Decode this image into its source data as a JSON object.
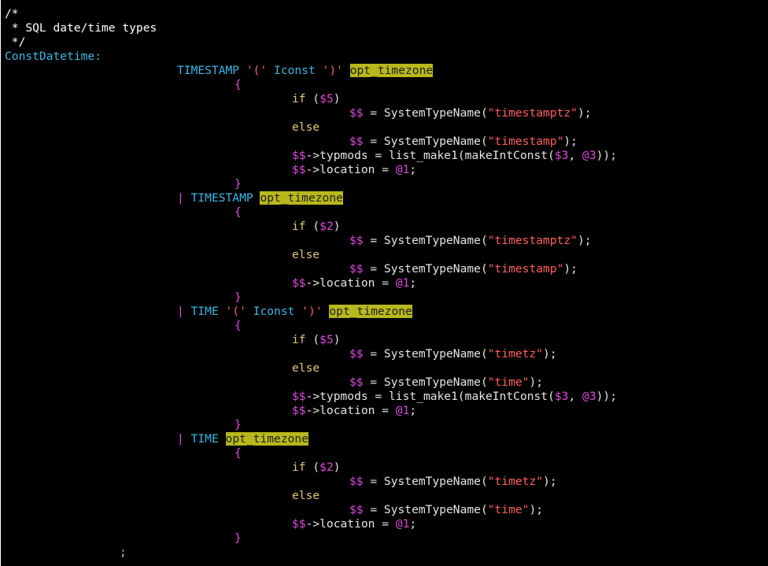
{
  "editor": {
    "background": "#000000",
    "colors": {
      "default": "#e5e5e5",
      "comment": "#ffffff",
      "label": "#3bb7e6",
      "keyword": "#e5c87a",
      "string": "#ff5f5f",
      "special": "#e048e0",
      "highlight_bg": "#b8b81c",
      "highlight_fg": "#202020"
    },
    "lines": [
      [
        {
          "t": "/*",
          "c": "comment"
        }
      ],
      [
        {
          "t": " * SQL date/time types",
          "c": "comment"
        }
      ],
      [
        {
          "t": " */",
          "c": "comment"
        }
      ],
      [
        {
          "t": "ConstDatetime:",
          "c": "label"
        }
      ],
      [
        {
          "t": "\t\t\t",
          "c": "default"
        },
        {
          "t": "TIMESTAMP",
          "c": "label"
        },
        {
          "t": " ",
          "c": "default"
        },
        {
          "t": "'('",
          "c": "string"
        },
        {
          "t": " ",
          "c": "default"
        },
        {
          "t": "Iconst",
          "c": "label"
        },
        {
          "t": " ",
          "c": "default"
        },
        {
          "t": "')'",
          "c": "string"
        },
        {
          "t": " ",
          "c": "default"
        },
        {
          "t": "opt_timezone",
          "c": "highlight"
        }
      ],
      [
        {
          "t": "\t\t\t\t",
          "c": "default"
        },
        {
          "t": "{",
          "c": "special"
        }
      ],
      [
        {
          "t": "\t\t\t\t\t",
          "c": "default"
        },
        {
          "t": "if",
          "c": "keyword"
        },
        {
          "t": " (",
          "c": "default"
        },
        {
          "t": "$5",
          "c": "special"
        },
        {
          "t": ")",
          "c": "default"
        }
      ],
      [
        {
          "t": "\t\t\t\t\t\t",
          "c": "default"
        },
        {
          "t": "$$",
          "c": "special"
        },
        {
          "t": " = SystemTypeName(",
          "c": "default"
        },
        {
          "t": "\"timestamptz\"",
          "c": "string"
        },
        {
          "t": ");",
          "c": "default"
        }
      ],
      [
        {
          "t": "\t\t\t\t\t",
          "c": "default"
        },
        {
          "t": "else",
          "c": "keyword"
        }
      ],
      [
        {
          "t": "\t\t\t\t\t\t",
          "c": "default"
        },
        {
          "t": "$$",
          "c": "special"
        },
        {
          "t": " = SystemTypeName(",
          "c": "default"
        },
        {
          "t": "\"timestamp\"",
          "c": "string"
        },
        {
          "t": ");",
          "c": "default"
        }
      ],
      [
        {
          "t": "\t\t\t\t\t",
          "c": "default"
        },
        {
          "t": "$$",
          "c": "special"
        },
        {
          "t": "->typmods = list_make1(makeIntConst(",
          "c": "default"
        },
        {
          "t": "$3",
          "c": "special"
        },
        {
          "t": ", ",
          "c": "default"
        },
        {
          "t": "@3",
          "c": "special"
        },
        {
          "t": "));",
          "c": "default"
        }
      ],
      [
        {
          "t": "\t\t\t\t\t",
          "c": "default"
        },
        {
          "t": "$$",
          "c": "special"
        },
        {
          "t": "->location = ",
          "c": "default"
        },
        {
          "t": "@1",
          "c": "special"
        },
        {
          "t": ";",
          "c": "default"
        }
      ],
      [
        {
          "t": "\t\t\t\t",
          "c": "default"
        },
        {
          "t": "}",
          "c": "special"
        }
      ],
      [
        {
          "t": "\t\t\t",
          "c": "default"
        },
        {
          "t": "|",
          "c": "special"
        },
        {
          "t": " ",
          "c": "default"
        },
        {
          "t": "TIMESTAMP",
          "c": "label"
        },
        {
          "t": " ",
          "c": "default"
        },
        {
          "t": "opt_timezone",
          "c": "highlight"
        }
      ],
      [
        {
          "t": "\t\t\t\t",
          "c": "default"
        },
        {
          "t": "{",
          "c": "special"
        }
      ],
      [
        {
          "t": "\t\t\t\t\t",
          "c": "default"
        },
        {
          "t": "if",
          "c": "keyword"
        },
        {
          "t": " (",
          "c": "default"
        },
        {
          "t": "$2",
          "c": "special"
        },
        {
          "t": ")",
          "c": "default"
        }
      ],
      [
        {
          "t": "\t\t\t\t\t\t",
          "c": "default"
        },
        {
          "t": "$$",
          "c": "special"
        },
        {
          "t": " = SystemTypeName(",
          "c": "default"
        },
        {
          "t": "\"timestamptz\"",
          "c": "string"
        },
        {
          "t": ");",
          "c": "default"
        }
      ],
      [
        {
          "t": "\t\t\t\t\t",
          "c": "default"
        },
        {
          "t": "else",
          "c": "keyword"
        }
      ],
      [
        {
          "t": "\t\t\t\t\t\t",
          "c": "default"
        },
        {
          "t": "$$",
          "c": "special"
        },
        {
          "t": " = SystemTypeName(",
          "c": "default"
        },
        {
          "t": "\"timestamp\"",
          "c": "string"
        },
        {
          "t": ");",
          "c": "default"
        }
      ],
      [
        {
          "t": "\t\t\t\t\t",
          "c": "default"
        },
        {
          "t": "$$",
          "c": "special"
        },
        {
          "t": "->location = ",
          "c": "default"
        },
        {
          "t": "@1",
          "c": "special"
        },
        {
          "t": ";",
          "c": "default"
        }
      ],
      [
        {
          "t": "\t\t\t\t",
          "c": "default"
        },
        {
          "t": "}",
          "c": "special"
        }
      ],
      [
        {
          "t": "\t\t\t",
          "c": "default"
        },
        {
          "t": "|",
          "c": "special"
        },
        {
          "t": " ",
          "c": "default"
        },
        {
          "t": "TIME",
          "c": "label"
        },
        {
          "t": " ",
          "c": "default"
        },
        {
          "t": "'('",
          "c": "string"
        },
        {
          "t": " ",
          "c": "default"
        },
        {
          "t": "Iconst",
          "c": "label"
        },
        {
          "t": " ",
          "c": "default"
        },
        {
          "t": "')'",
          "c": "string"
        },
        {
          "t": " ",
          "c": "default"
        },
        {
          "t": "opt_timezone",
          "c": "highlight"
        }
      ],
      [
        {
          "t": "\t\t\t\t",
          "c": "default"
        },
        {
          "t": "{",
          "c": "special"
        }
      ],
      [
        {
          "t": "\t\t\t\t\t",
          "c": "default"
        },
        {
          "t": "if",
          "c": "keyword"
        },
        {
          "t": " (",
          "c": "default"
        },
        {
          "t": "$5",
          "c": "special"
        },
        {
          "t": ")",
          "c": "default"
        }
      ],
      [
        {
          "t": "\t\t\t\t\t\t",
          "c": "default"
        },
        {
          "t": "$$",
          "c": "special"
        },
        {
          "t": " = SystemTypeName(",
          "c": "default"
        },
        {
          "t": "\"timetz\"",
          "c": "string"
        },
        {
          "t": ");",
          "c": "default"
        }
      ],
      [
        {
          "t": "\t\t\t\t\t",
          "c": "default"
        },
        {
          "t": "else",
          "c": "keyword"
        }
      ],
      [
        {
          "t": "\t\t\t\t\t\t",
          "c": "default"
        },
        {
          "t": "$$",
          "c": "special"
        },
        {
          "t": " = SystemTypeName(",
          "c": "default"
        },
        {
          "t": "\"time\"",
          "c": "string"
        },
        {
          "t": ");",
          "c": "default"
        }
      ],
      [
        {
          "t": "\t\t\t\t\t",
          "c": "default"
        },
        {
          "t": "$$",
          "c": "special"
        },
        {
          "t": "->typmods = list_make1(makeIntConst(",
          "c": "default"
        },
        {
          "t": "$3",
          "c": "special"
        },
        {
          "t": ", ",
          "c": "default"
        },
        {
          "t": "@3",
          "c": "special"
        },
        {
          "t": "));",
          "c": "default"
        }
      ],
      [
        {
          "t": "\t\t\t\t\t",
          "c": "default"
        },
        {
          "t": "$$",
          "c": "special"
        },
        {
          "t": "->location = ",
          "c": "default"
        },
        {
          "t": "@1",
          "c": "special"
        },
        {
          "t": ";",
          "c": "default"
        }
      ],
      [
        {
          "t": "\t\t\t\t",
          "c": "default"
        },
        {
          "t": "}",
          "c": "special"
        }
      ],
      [
        {
          "t": "\t\t\t",
          "c": "default"
        },
        {
          "t": "|",
          "c": "special"
        },
        {
          "t": " ",
          "c": "default"
        },
        {
          "t": "TIME",
          "c": "label"
        },
        {
          "t": " ",
          "c": "default"
        },
        {
          "t": "opt_timezone",
          "c": "highlight"
        }
      ],
      [
        {
          "t": "\t\t\t\t",
          "c": "default"
        },
        {
          "t": "{",
          "c": "special"
        }
      ],
      [
        {
          "t": "\t\t\t\t\t",
          "c": "default"
        },
        {
          "t": "if",
          "c": "keyword"
        },
        {
          "t": " (",
          "c": "default"
        },
        {
          "t": "$2",
          "c": "special"
        },
        {
          "t": ")",
          "c": "default"
        }
      ],
      [
        {
          "t": "\t\t\t\t\t\t",
          "c": "default"
        },
        {
          "t": "$$",
          "c": "special"
        },
        {
          "t": " = SystemTypeName(",
          "c": "default"
        },
        {
          "t": "\"timetz\"",
          "c": "string"
        },
        {
          "t": ");",
          "c": "default"
        }
      ],
      [
        {
          "t": "\t\t\t\t\t",
          "c": "default"
        },
        {
          "t": "else",
          "c": "keyword"
        }
      ],
      [
        {
          "t": "\t\t\t\t\t\t",
          "c": "default"
        },
        {
          "t": "$$",
          "c": "special"
        },
        {
          "t": " = SystemTypeName(",
          "c": "default"
        },
        {
          "t": "\"time\"",
          "c": "string"
        },
        {
          "t": ");",
          "c": "default"
        }
      ],
      [
        {
          "t": "\t\t\t\t\t",
          "c": "default"
        },
        {
          "t": "$$",
          "c": "special"
        },
        {
          "t": "->location = ",
          "c": "default"
        },
        {
          "t": "@1",
          "c": "special"
        },
        {
          "t": ";",
          "c": "default"
        }
      ],
      [
        {
          "t": "\t\t\t\t",
          "c": "default"
        },
        {
          "t": "}",
          "c": "special"
        }
      ],
      [
        {
          "t": "\t\t",
          "c": "default"
        },
        {
          "t": ";",
          "c": "keyword"
        }
      ]
    ]
  }
}
